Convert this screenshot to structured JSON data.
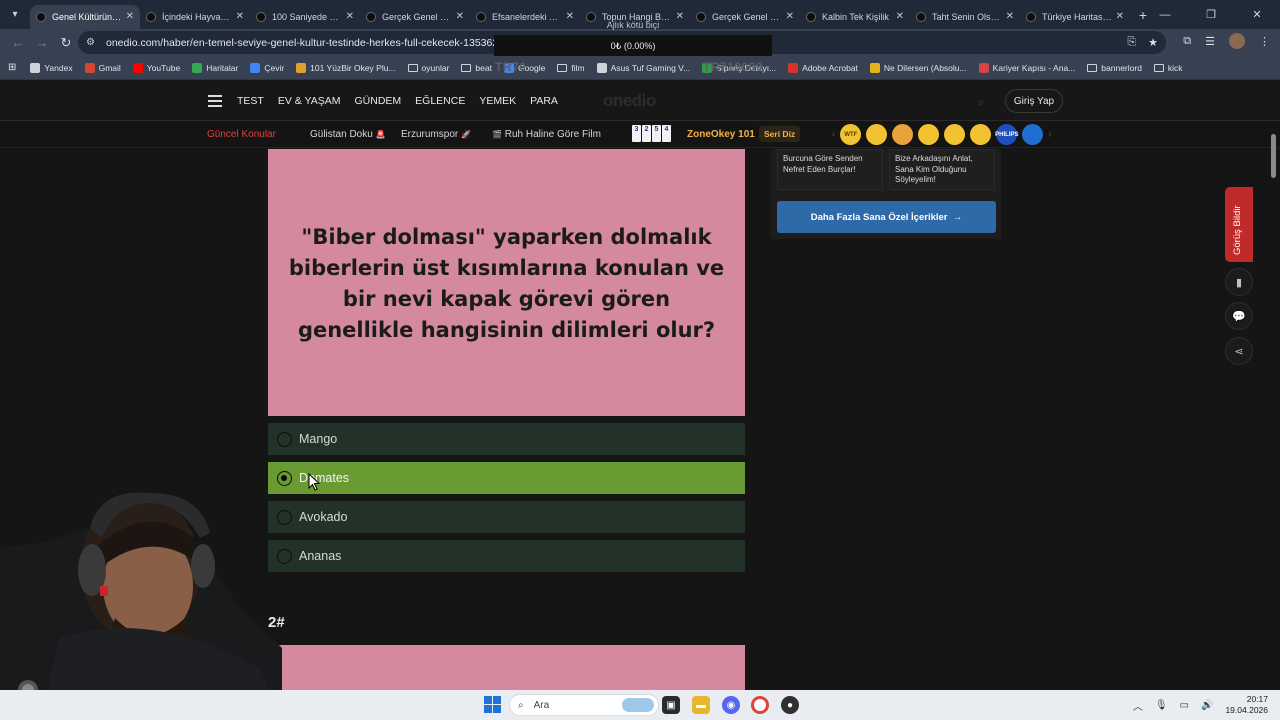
{
  "browser": {
    "tabs": [
      {
        "title": "Genel Kültürüne G",
        "active": true
      },
      {
        "title": "İçindeki Hayvan G",
        "active": false
      },
      {
        "title": "100 Saniyede Kaç",
        "active": false
      },
      {
        "title": "Gerçek Genel Kült",
        "active": false
      },
      {
        "title": "Efsanelerdeki Yer",
        "active": false
      },
      {
        "title": "Topun Hangi Bard",
        "active": false
      },
      {
        "title": "Gerçek Genel Kült",
        "active": false
      },
      {
        "title": "Kalbin Tek Kişilik",
        "active": false
      },
      {
        "title": "Taht Senin Olsayd",
        "active": false
      },
      {
        "title": "Türkiye Haritası Ş",
        "active": false
      }
    ],
    "url": "onedio.com/haber/en-temel-seviye-genel-kultur-testinde-herkes-full-cekecek-1353622",
    "bookmarks": [
      {
        "label": "Yandex",
        "color": "#cfd4dc",
        "type": "site"
      },
      {
        "label": "Gmail",
        "color": "#d44638",
        "type": "site"
      },
      {
        "label": "YouTube",
        "color": "#ff0000",
        "type": "site"
      },
      {
        "label": "Haritalar",
        "color": "#34a853",
        "type": "site"
      },
      {
        "label": "Çevir",
        "color": "#4285f4",
        "type": "site"
      },
      {
        "label": "101 YüzBir Okey Plu...",
        "color": "#e0a030",
        "type": "site"
      },
      {
        "label": "oyunlar",
        "color": "",
        "type": "folder"
      },
      {
        "label": "beat",
        "color": "",
        "type": "folder"
      },
      {
        "label": "Google",
        "color": "#4285f4",
        "type": "site"
      },
      {
        "label": "film",
        "color": "",
        "type": "folder"
      },
      {
        "label": "Asus Tuf Gaming V...",
        "color": "#cfd4dc",
        "type": "site"
      },
      {
        "label": "Sipariş Detayı...",
        "color": "#2f9e44",
        "type": "site"
      },
      {
        "label": "Adobe Acrobat",
        "color": "#d7332c",
        "type": "site"
      },
      {
        "label": "Ne Dilersen (Absolu...",
        "color": "#e9b21a",
        "type": "site"
      },
      {
        "label": "Kariyer Kapısı - Ana...",
        "color": "#d64545",
        "type": "site"
      },
      {
        "label": "bannerlord",
        "color": "",
        "type": "folder"
      },
      {
        "label": "kick",
        "color": "",
        "type": "folder"
      }
    ],
    "overlay_top": "Ajlık kötü biçi",
    "overlay_box": "0₺ (0.00%)",
    "watermark_left": "TR70",
    "watermark_right": "TR710000"
  },
  "site": {
    "logo": "onedio",
    "nav": [
      "TEST",
      "EV & YAŞAM",
      "GÜNDEM",
      "EĞLENCE",
      "YEMEK",
      "PARA"
    ],
    "login": "Giriş Yap",
    "subnav": {
      "trending_label": "Güncel Konular",
      "items": [
        "Gülistan Doku",
        "Erzurumspor",
        "Ruh Haline Göre Film"
      ],
      "okey_tiles": [
        "3",
        "2",
        "5",
        "4"
      ],
      "okey_label": "ZoneOkey 101",
      "badge": "Seri Diz"
    },
    "emoji_row": [
      {
        "name": "wtf-emoji",
        "label": "WTF",
        "color": "#f1c232"
      },
      {
        "name": "nerd-emoji",
        "label": "",
        "color": "#f1c232"
      },
      {
        "name": "smile-emoji",
        "label": "",
        "color": "#e8a33c"
      },
      {
        "name": "love-emoji",
        "label": "",
        "color": "#f1c232"
      },
      {
        "name": "sad-emoji",
        "label": "",
        "color": "#f1c232"
      },
      {
        "name": "laugh-emoji",
        "label": "",
        "color": "#f1c232"
      },
      {
        "name": "philips-badge",
        "label": "PHILIPS",
        "color": "#1f4fbf"
      },
      {
        "name": "brand-badge",
        "label": "",
        "color": "#1f6fd0"
      }
    ]
  },
  "quiz": {
    "question": "\"Biber dolması\" yaparken dolmalık biberlerin üst kısımlarına konulan ve bir nevi kapak görevi gören genellikle hangisinin dilimleri olur?",
    "options": [
      {
        "label": "Mango",
        "selected": false
      },
      {
        "label": "Domates",
        "selected": true
      },
      {
        "label": "Avokado",
        "selected": false
      },
      {
        "label": "Ananas",
        "selected": false
      }
    ],
    "next_number": "2#"
  },
  "sidebar": {
    "cards": [
      "Burcuna Göre Senden Nefret Eden Burçlar!",
      "Bize Arkadaşını Anlat, Sana Kim Olduğunu Söyleyelim!"
    ],
    "more_button": "Daha Fazla Sana Özel İçerikler"
  },
  "feedback": "Görüş Bildir",
  "taskbar": {
    "search_placeholder": "Ara",
    "time": "20:17",
    "date": "19.04.2026"
  },
  "colors": {
    "quiz_bg": "#d4899e",
    "option_bg": "#223228",
    "option_selected": "#6a9b32",
    "accent_red": "#e2403b"
  }
}
